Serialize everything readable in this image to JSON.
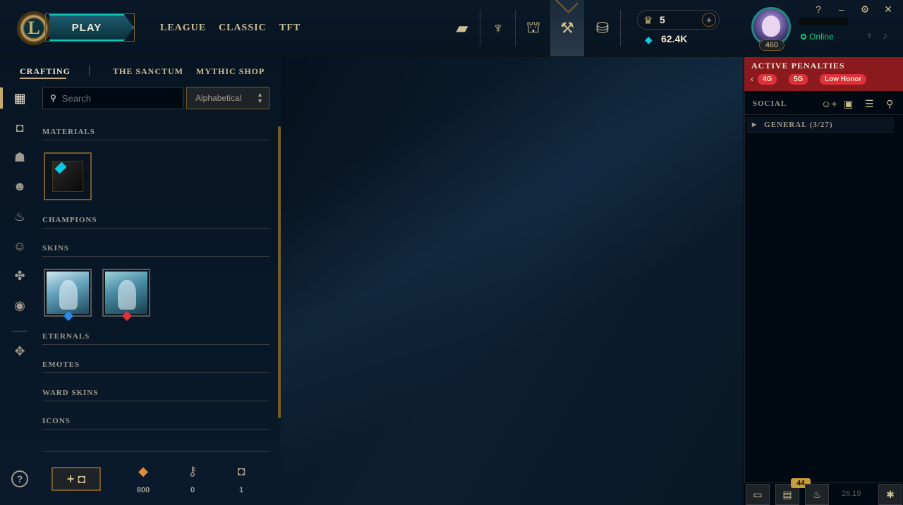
{
  "topbar": {
    "logo_letter": "L",
    "play_label": "PLAY",
    "modes": [
      "LEAGUE",
      "CLASSIC",
      "TFT"
    ],
    "nav_icons": [
      {
        "name": "collection-icon",
        "glyph": "▰"
      },
      {
        "name": "tft-icon",
        "glyph": "♆"
      },
      {
        "name": "loot-icon",
        "glyph": "⛫"
      },
      {
        "name": "crafting-icon",
        "glyph": "⚒"
      },
      {
        "name": "store-icon",
        "glyph": "⛁"
      }
    ],
    "rp_amount": "5",
    "be_amount": "62.4K",
    "add_label": "+"
  },
  "profile": {
    "level": "460",
    "status": "Online"
  },
  "window": {
    "help": "?",
    "minimize": "–",
    "settings": "⚙",
    "close": "✕"
  },
  "subnav": {
    "tabs": [
      "CRAFTING",
      "THE SANCTUM",
      "MYTHIC SHOP"
    ]
  },
  "sidebar": {
    "icons": [
      {
        "name": "all-items-icon",
        "glyph": "▦"
      },
      {
        "name": "chest-icon",
        "glyph": "◘"
      },
      {
        "name": "champion-icon",
        "glyph": "☗"
      },
      {
        "name": "skin-icon",
        "glyph": "☻"
      },
      {
        "name": "eternals-icon",
        "glyph": "♨"
      },
      {
        "name": "emote-icon",
        "glyph": "☺"
      },
      {
        "name": "ward-icon",
        "glyph": "✤"
      },
      {
        "name": "profile-icon-icon",
        "glyph": "◉"
      },
      {
        "name": "other-icon",
        "glyph": "✥"
      }
    ]
  },
  "search": {
    "placeholder": "Search",
    "sort_value": "Alphabetical"
  },
  "sections": {
    "materials": "MATERIALS",
    "champions": "CHAMPIONS",
    "skins": "SKINS",
    "eternals": "ETERNALS",
    "emotes": "EMOTES",
    "ward_skins": "WARD SKINS",
    "icons": "ICONS"
  },
  "rarity_colors": {
    "skin1": "#2a8ae6",
    "skin2": "#e0303a"
  },
  "bottom": {
    "help": "?",
    "add_chest": "+ ◘",
    "resources": [
      {
        "name": "orange-essence-icon",
        "glyph": "◆",
        "count": "800",
        "color": "#e08a3a"
      },
      {
        "name": "key-icon",
        "glyph": "⚷",
        "count": "0",
        "color": "#a09b8c"
      },
      {
        "name": "chest-count-icon",
        "glyph": "◘",
        "count": "1",
        "color": "#a09b8c"
      }
    ]
  },
  "penalties": {
    "title": "ACTIVE PENALTIES",
    "arrow": "‹",
    "badges": [
      "4G",
      "5G",
      "Low Honor"
    ]
  },
  "social": {
    "label": "SOCIAL",
    "group": "GENERAL (3/27)",
    "group_arrow": "▶"
  },
  "footer": {
    "notifications": "44",
    "version": "26.19"
  }
}
